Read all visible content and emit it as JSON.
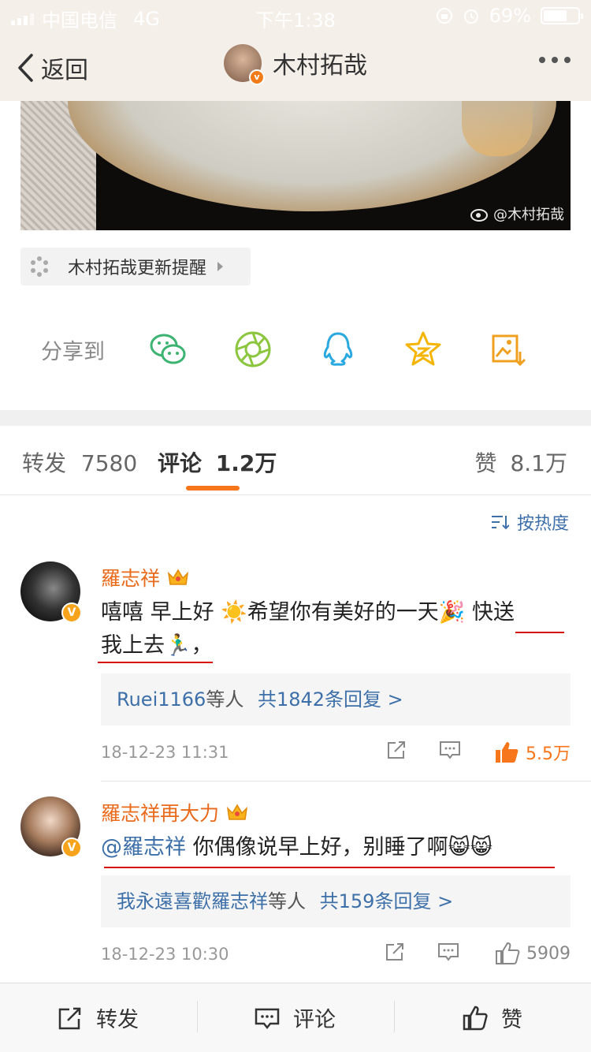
{
  "status_bar": {
    "carrier": "中国电信",
    "network": "4G",
    "time": "下午1:38",
    "battery": "69%",
    "battery_level": 0.69
  },
  "header": {
    "back_label": "返回",
    "title": "木村拓哉"
  },
  "photo": {
    "watermark": "@木村拓哉"
  },
  "update_reminder": {
    "label": "木村拓哉更新提醒"
  },
  "share": {
    "label": "分享到",
    "targets": [
      "wechat-icon",
      "moments-icon",
      "qq-icon",
      "qzone-icon",
      "save-image-icon"
    ]
  },
  "tabs": {
    "repost": {
      "label": "转发",
      "count": "7580"
    },
    "comment": {
      "label": "评论",
      "count": "1.2万"
    },
    "like": {
      "label": "赞",
      "count": "8.1万"
    }
  },
  "sort": {
    "label": "按热度"
  },
  "comments": [
    {
      "name": "羅志祥",
      "text_line1": "嘻嘻 早上好 ☀️希望你有美好的一天🎉 快送",
      "text_line2": "我上去🏃‍♂️，",
      "reply_users": "Ruei1166",
      "reply_mid": "等人",
      "reply_count": "共1842条回复 >",
      "date": "18-12-23 11:31",
      "likes": "5.5万",
      "liked": true
    },
    {
      "name": "羅志祥再大力",
      "mention": "@羅志祥",
      "text": " 你偶像说早上好，别睡了啊😸😸",
      "reply_users": "我永遠喜歡羅志祥",
      "reply_mid": "等人",
      "reply_count": "共159条回复 >",
      "date": "18-12-23 10:30",
      "likes": "5909",
      "liked": false
    }
  ],
  "bottom_bar": {
    "repost": "转发",
    "comment": "评论",
    "like": "赞"
  },
  "colors": {
    "accent": "#f7761c",
    "link": "#3d6fa8",
    "username": "#e86a1a",
    "liked": "#f7761c"
  }
}
